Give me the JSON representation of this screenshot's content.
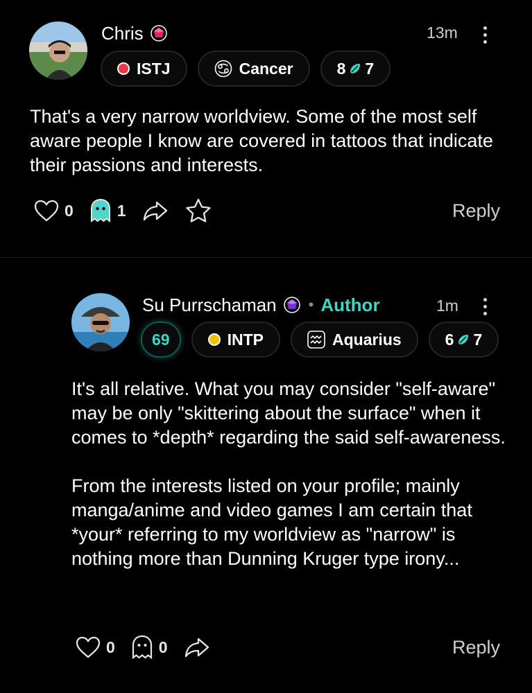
{
  "comments": [
    {
      "author": "Chris",
      "time": "13m",
      "badges": {
        "mbti": "ISTJ",
        "zodiac": "Cancer",
        "enneagram_left": "8",
        "enneagram_right": "7"
      },
      "body": "That's a very narrow worldview. Some of the most self aware people I know are covered in tattoos that indicate their passions and interests.",
      "likes": "0",
      "ghosts": "1",
      "reply_label": "Reply",
      "colors": {
        "gem": "#e0245e",
        "mbti_dot": "#e8384a"
      }
    },
    {
      "author": "Su Purrschaman",
      "author_tag": "Author",
      "time": "1m",
      "score": "69",
      "badges": {
        "mbti": "INTP",
        "zodiac": "Aquarius",
        "enneagram_left": "6",
        "enneagram_right": "7"
      },
      "body": "It's all relative. What you may consider \"self-aware\" may be only \"skittering about the surface\" when it comes to *depth* regarding the said self-awareness.\n\nFrom the interests listed on your profile; mainly manga/anime and video games I am certain that *your* referring to my worldview as \"narrow\" is nothing more than Dunning Kruger type irony...",
      "likes": "0",
      "ghosts": "0",
      "reply_label": "Reply",
      "colors": {
        "gem": "#7b2fd6",
        "mbti_dot": "#f2c200",
        "author_tag": "#3fd6c4"
      }
    }
  ],
  "icons": [
    "heart-icon",
    "ghost-icon",
    "share-icon",
    "star-icon",
    "more-icon",
    "gem-icon",
    "cancer-icon",
    "aquarius-icon",
    "enneagram-gem-icon"
  ]
}
